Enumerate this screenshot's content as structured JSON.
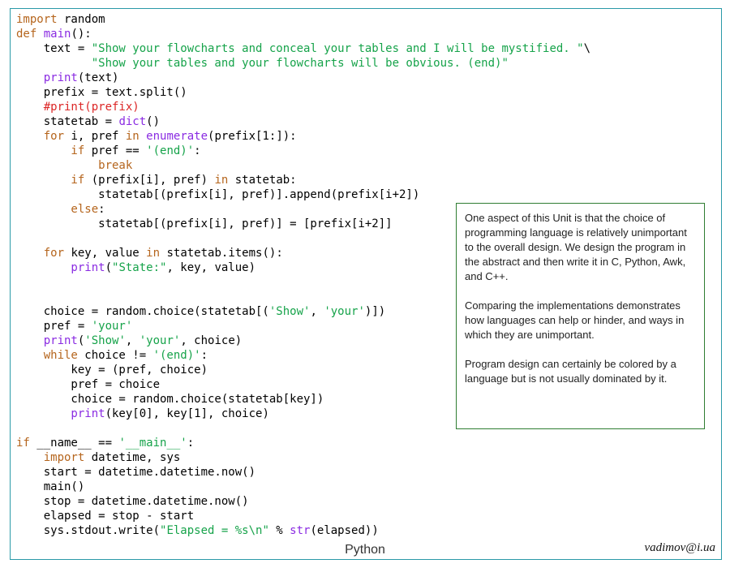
{
  "colors": {
    "keyword": "#b5651d",
    "builtin": "#8a2be2",
    "string": "#16a34a",
    "comment": "#dc2626",
    "text": "#000000",
    "frame": "#2a9aa8",
    "note_border": "#2f7d32"
  },
  "code_lines": [
    [
      [
        "kw",
        "import"
      ],
      [
        "pl",
        " random"
      ]
    ],
    [
      [
        "kw",
        "def"
      ],
      [
        "pl",
        " "
      ],
      [
        "bi",
        "main"
      ],
      [
        "pl",
        "():"
      ]
    ],
    [
      [
        "pl",
        "    text = "
      ],
      [
        "st",
        "\"Show your flowcharts and conceal your tables and I will be mystified. \""
      ],
      [
        "pl",
        "\\"
      ]
    ],
    [
      [
        "st",
        "           \"Show your tables and your flowcharts will be obvious. (end)\""
      ]
    ],
    [
      [
        "bi",
        "    print"
      ],
      [
        "pl",
        "(text)"
      ]
    ],
    [
      [
        "pl",
        "    prefix = text.split()"
      ]
    ],
    [
      [
        "cm",
        "    #print(prefix)"
      ]
    ],
    [
      [
        "pl",
        "    statetab = "
      ],
      [
        "bi",
        "dict"
      ],
      [
        "pl",
        "()"
      ]
    ],
    [
      [
        "kw",
        "    for"
      ],
      [
        "pl",
        " i, pref "
      ],
      [
        "kw",
        "in"
      ],
      [
        "pl",
        " "
      ],
      [
        "bi",
        "enumerate"
      ],
      [
        "pl",
        "(prefix[1:]):"
      ]
    ],
    [
      [
        "kw",
        "        if"
      ],
      [
        "pl",
        " pref == "
      ],
      [
        "st",
        "'(end)'"
      ],
      [
        "pl",
        ":"
      ]
    ],
    [
      [
        "kw",
        "            break"
      ]
    ],
    [
      [
        "kw",
        "        if"
      ],
      [
        "pl",
        " (prefix[i], pref) "
      ],
      [
        "kw",
        "in"
      ],
      [
        "pl",
        " statetab:"
      ]
    ],
    [
      [
        "pl",
        "            statetab[(prefix[i], pref)].append(prefix[i+2])"
      ]
    ],
    [
      [
        "kw",
        "        else"
      ],
      [
        "pl",
        ":"
      ]
    ],
    [
      [
        "pl",
        "            statetab[(prefix[i], pref)] = [prefix[i+2]]"
      ]
    ],
    [],
    [
      [
        "kw",
        "    for"
      ],
      [
        "pl",
        " key, value "
      ],
      [
        "kw",
        "in"
      ],
      [
        "pl",
        " statetab.items():"
      ]
    ],
    [
      [
        "bi",
        "        print"
      ],
      [
        "pl",
        "("
      ],
      [
        "st",
        "\"State:\""
      ],
      [
        "pl",
        ", key, value)"
      ]
    ],
    [],
    [],
    [
      [
        "pl",
        "    choice = random.choice(statetab[("
      ],
      [
        "st",
        "'Show'"
      ],
      [
        "pl",
        ", "
      ],
      [
        "st",
        "'your'"
      ],
      [
        "pl",
        ")])"
      ]
    ],
    [
      [
        "pl",
        "    pref = "
      ],
      [
        "st",
        "'your'"
      ]
    ],
    [
      [
        "bi",
        "    print"
      ],
      [
        "pl",
        "("
      ],
      [
        "st",
        "'Show'"
      ],
      [
        "pl",
        ", "
      ],
      [
        "st",
        "'your'"
      ],
      [
        "pl",
        ", choice)"
      ]
    ],
    [
      [
        "kw",
        "    while"
      ],
      [
        "pl",
        " choice != "
      ],
      [
        "st",
        "'(end)'"
      ],
      [
        "pl",
        ":"
      ]
    ],
    [
      [
        "pl",
        "        key = (pref, choice)"
      ]
    ],
    [
      [
        "pl",
        "        pref = choice"
      ]
    ],
    [
      [
        "pl",
        "        choice = random.choice(statetab[key])"
      ]
    ],
    [
      [
        "bi",
        "        print"
      ],
      [
        "pl",
        "(key[0], key[1], choice)"
      ]
    ],
    [],
    [
      [
        "kw",
        "if"
      ],
      [
        "pl",
        " __name__ == "
      ],
      [
        "st",
        "'__main__'"
      ],
      [
        "pl",
        ":"
      ]
    ],
    [
      [
        "kw",
        "    import"
      ],
      [
        "pl",
        " datetime, sys"
      ]
    ],
    [
      [
        "pl",
        "    start = datetime.datetime.now()"
      ]
    ],
    [
      [
        "pl",
        "    main()"
      ]
    ],
    [
      [
        "pl",
        "    stop = datetime.datetime.now()"
      ]
    ],
    [
      [
        "pl",
        "    elapsed = stop - start"
      ]
    ],
    [
      [
        "pl",
        "    sys.stdout.write("
      ],
      [
        "st",
        "\"Elapsed = %s\\n\""
      ],
      [
        "pl",
        " % "
      ],
      [
        "bi",
        "str"
      ],
      [
        "pl",
        "(elapsed))"
      ]
    ]
  ],
  "note": {
    "paragraphs": [
      "One aspect of this Unit is that the choice of programming language is relatively unimportant to the overall design. We design the program in the abstract and then write it in C, Python, Awk, and C++.",
      "Comparing the implementations demonstrates how languages can help or hinder, and ways in which they are unimportant.",
      "Program design can certainly be colored by a language but is not usually dominated by it."
    ]
  },
  "footer": {
    "title": "Python",
    "email": "vadimov@i.ua"
  }
}
